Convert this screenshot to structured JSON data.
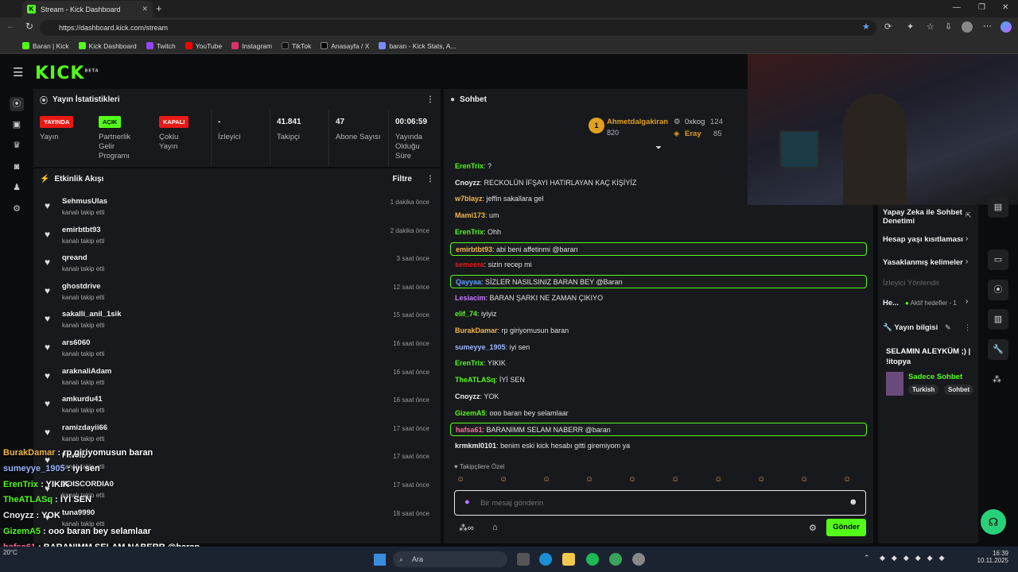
{
  "browser": {
    "tab_title": "Stream - Kick Dashboard",
    "url": "https://dashboard.kick.com/stream",
    "bookmarks": [
      "Baran | Kick",
      "Kick Dashboard",
      "Twitch",
      "YouTube",
      "Instagram",
      "TikTok",
      "Anasayfa / X",
      "baran - Kick Stats, A..."
    ]
  },
  "app": {
    "logo": "KICK",
    "beta": "BETA"
  },
  "stats_panel": {
    "title": "Yayın İstatistikleri",
    "badges": [
      {
        "text": "YAYINDA",
        "label": "Yayın",
        "color": "#e91916"
      },
      {
        "text": "AÇIK",
        "label": "Partnerlik Gelir Programı",
        "color": "#53fc18"
      },
      {
        "text": "KAPALI",
        "label": "Çoklu Yayın",
        "color": "#e91916"
      }
    ],
    "values": [
      {
        "value": "-",
        "label": "İzleyici"
      },
      {
        "value": "41.841",
        "label": "Takipçi"
      },
      {
        "value": "47",
        "label": "Abone Sayısı"
      },
      {
        "value": "00:06:59",
        "label": "Yayında Olduğu Süre"
      }
    ]
  },
  "activity": {
    "title": "Etkinlik Akışı",
    "filter": "Filtre",
    "sub": "kanalı takip etti",
    "items": [
      [
        "SehmusUlas",
        "1 dakika önce"
      ],
      [
        "emirbtbt93",
        "2 dakika önce"
      ],
      [
        "qreand",
        "3 saat önce"
      ],
      [
        "ghostdrive",
        "12 saat önce"
      ],
      [
        "sakalli_anil_1sik",
        "15 saat önce"
      ],
      [
        "ars6060",
        "16 saat önce"
      ],
      [
        "araknaliAdam",
        "16 saat önce"
      ],
      [
        "amkurdu41",
        "16 saat önce"
      ],
      [
        "ramizdayii66",
        "17 saat önce"
      ],
      [
        "Favelo",
        "17 saat önce"
      ],
      [
        "XDISCORDIA0",
        "17 saat önce"
      ],
      [
        "tuna9990",
        "18 saat önce"
      ]
    ]
  },
  "chat": {
    "title": "Sohbet",
    "top": [
      {
        "rank": "1",
        "name": "Ahmetdalgakiran",
        "count": "820"
      },
      {
        "name": "0xkog",
        "count": "124"
      },
      {
        "name": "Eray",
        "count": "85"
      }
    ],
    "messages": [
      {
        "u": "ErenTrix",
        "c": "#53fc18",
        "t": "?"
      },
      {
        "u": "Cnoyzz",
        "c": "#eeeeee",
        "t": "RECKOLÜN İFŞAYI HATIRLAYAN KAÇ KİŞİYİZ"
      },
      {
        "u": "w7blayz",
        "c": "#f2b84b",
        "t": "jeffin sakallara gel"
      },
      {
        "u": "Mami173",
        "c": "#f2b84b",
        "t": "um"
      },
      {
        "u": "ErenTrix",
        "c": "#53fc18",
        "t": "Ohh"
      },
      {
        "u": "emirbtbt93",
        "c": "#f2b84b",
        "t": "abi beni affetinmi @baran",
        "hl": true
      },
      {
        "u": "semeera",
        "c": "#e91916",
        "t": "sizin recep mi"
      },
      {
        "u": "Qayyaa",
        "c": "#5aa0ff",
        "t": "SİZLER NASILSINIZ BARAN BEY @Baran",
        "hl": true
      },
      {
        "u": "Lesiacim",
        "c": "#c879ff",
        "t": "BARAN ŞARKI NE ZAMAN ÇIKIYO"
      },
      {
        "u": "elif_74",
        "c": "#53fc18",
        "t": "iyiyiz"
      },
      {
        "u": "BurakDamar",
        "c": "#f2b84b",
        "t": "rp giriyomusun baran"
      },
      {
        "u": "sumeyye_1905",
        "c": "#9bb6ff",
        "t": "iyi sen"
      },
      {
        "u": "ErenTrix",
        "c": "#53fc18",
        "t": "YIKIK"
      },
      {
        "u": "TheATLASq",
        "c": "#53fc18",
        "t": "İYİ SEN"
      },
      {
        "u": "Cnoyzz",
        "c": "#eeeeee",
        "t": "YOK"
      },
      {
        "u": "GizemA5",
        "c": "#53fc18",
        "t": "ooo baran bey selamlaar"
      },
      {
        "u": "hafsa61",
        "c": "#ff6b9b",
        "t": "BARANIMM SELAM NABERR @baran",
        "hl": true
      },
      {
        "u": "krmkml0101",
        "c": "#eeeeee",
        "t": "benim eski kick hesabı gitti giremiyom ya"
      }
    ],
    "followers_only": "Takipçilere Özel",
    "placeholder": "Bir mesaj gönderin",
    "send": "Gönder"
  },
  "right_panel": {
    "items": [
      "Yapay Zeka ile Sohbet Denetimi",
      "Hesap yaşı kısıtlaması",
      "Yasaklanmış kelimeler",
      "İzleyici Yönlendir",
      "He...",
      "Aktif hedefler - 1"
    ],
    "stream_info": {
      "title": "Yayın bilgisi",
      "stream_title": "SELAMIN ALEYKÜM ;) | !itopya",
      "category": "Sadece Sohbet",
      "tags": [
        "Turkish",
        "Sohbet"
      ]
    }
  },
  "overlay": [
    {
      "u": "BurakDamar",
      "c": "#f2b84b",
      "t": "rp giriyomusun baran"
    },
    {
      "u": "sumeyye_1905",
      "c": "#9bb6ff",
      "t": "iyi sen"
    },
    {
      "u": "ErenTrix",
      "c": "#53fc18",
      "t": "YIKIK"
    },
    {
      "u": "TheATLASq",
      "c": "#53fc18",
      "t": "İYİ SEN"
    },
    {
      "u": "Cnoyzz",
      "c": "#eeeeee",
      "t": "YOK"
    },
    {
      "u": "GizemA5",
      "c": "#53fc18",
      "t": "ooo baran bey selamlaar"
    },
    {
      "u": "hafsa61",
      "c": "#ff6b9b",
      "t": "BARANIMM SELAM NABERR @baran"
    },
    {
      "u": "krmkml0101",
      "c": "#eeeeee",
      "t": "benim eski kick hesabı gitti giremiyom ya"
    }
  ],
  "taskbar": {
    "search": "Ara",
    "time": "16:39",
    "date": "10.11.2025",
    "weather": "20°C"
  }
}
